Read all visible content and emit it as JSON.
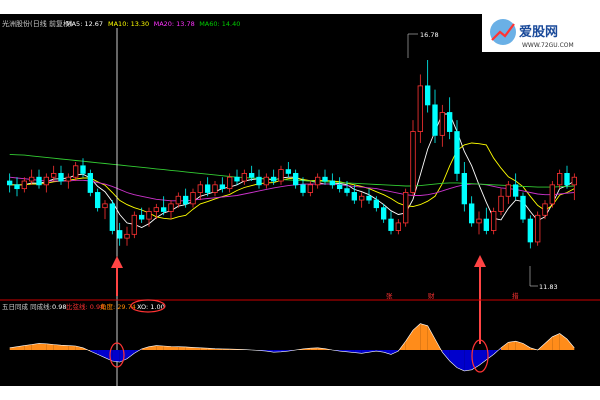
{
  "header": {
    "stock_name": "光洲股份(日线 前复权)",
    "ma_items": [
      {
        "label": "MA5: 12.67",
        "color": "#ffffff"
      },
      {
        "label": "MA10: 13.30",
        "color": "#ffff00"
      },
      {
        "label": "MA20: 13.78",
        "color": "#ff33ff"
      },
      {
        "label": "MA60: 14.40",
        "color": "#00cc00"
      }
    ]
  },
  "logo": {
    "name": "爱股网",
    "url": "WWW.72GU.COM"
  },
  "price_annotations": {
    "high": "16.78",
    "low": "11.83"
  },
  "bottom_markers": [
    "张",
    "财",
    "措"
  ],
  "indicator_header": {
    "name": "五日同成 同成线:",
    "value": "0.98",
    "item1": "比弦线: 0.94",
    "item2": "角度: 29.74",
    "item3": "XO: 1.00"
  },
  "colors": {
    "background": "#000000",
    "up_candle": "#ff3333",
    "down_candle": "#00ffff",
    "ma5": "#ffffff",
    "ma10": "#ffff00",
    "ma20": "#cc33cc",
    "ma60": "#33cc33",
    "divider": "#cc0000",
    "osc_positive": "#ff8c1a",
    "osc_negative": "#0000cc",
    "arrow": "#ff4444",
    "highlight_circle": "#ff3333"
  },
  "chart_data": {
    "type": "candlestick",
    "title": "",
    "ylim": [
      11.0,
      17.2
    ],
    "candles": [
      [
        13.6,
        13.8,
        13.3,
        13.5
      ],
      [
        13.5,
        13.7,
        13.2,
        13.4
      ],
      [
        13.4,
        13.7,
        13.3,
        13.6
      ],
      [
        13.6,
        13.9,
        13.5,
        13.7
      ],
      [
        13.7,
        13.9,
        13.4,
        13.5
      ],
      [
        13.5,
        13.8,
        13.3,
        13.7
      ],
      [
        13.7,
        14.0,
        13.6,
        13.8
      ],
      [
        13.8,
        14.0,
        13.5,
        13.6
      ],
      [
        13.6,
        13.8,
        13.4,
        13.7
      ],
      [
        13.7,
        14.1,
        13.6,
        14.0
      ],
      [
        14.0,
        14.2,
        13.7,
        13.8
      ],
      [
        13.8,
        13.9,
        13.2,
        13.3
      ],
      [
        13.3,
        13.4,
        12.8,
        12.9
      ],
      [
        12.9,
        13.1,
        12.6,
        13.0
      ],
      [
        13.0,
        13.1,
        12.2,
        12.3
      ],
      [
        12.3,
        12.5,
        11.9,
        12.1
      ],
      [
        12.1,
        12.4,
        11.9,
        12.2
      ],
      [
        12.2,
        12.8,
        12.1,
        12.7
      ],
      [
        12.7,
        12.9,
        12.5,
        12.6
      ],
      [
        12.6,
        12.9,
        12.4,
        12.8
      ],
      [
        12.8,
        13.0,
        12.6,
        12.9
      ],
      [
        12.9,
        13.2,
        12.7,
        12.8
      ],
      [
        12.8,
        13.1,
        12.6,
        13.0
      ],
      [
        13.0,
        13.3,
        12.9,
        13.2
      ],
      [
        13.2,
        13.4,
        12.9,
        13.0
      ],
      [
        13.0,
        13.4,
        12.9,
        13.3
      ],
      [
        13.3,
        13.6,
        13.1,
        13.5
      ],
      [
        13.5,
        13.7,
        13.2,
        13.3
      ],
      [
        13.3,
        13.6,
        13.2,
        13.5
      ],
      [
        13.5,
        13.7,
        13.3,
        13.4
      ],
      [
        13.4,
        13.8,
        13.3,
        13.7
      ],
      [
        13.7,
        13.9,
        13.5,
        13.6
      ],
      [
        13.6,
        13.9,
        13.5,
        13.8
      ],
      [
        13.8,
        14.0,
        13.6,
        13.7
      ],
      [
        13.7,
        13.9,
        13.4,
        13.5
      ],
      [
        13.5,
        13.8,
        13.4,
        13.7
      ],
      [
        13.7,
        13.9,
        13.5,
        13.6
      ],
      [
        13.6,
        14.0,
        13.5,
        13.9
      ],
      [
        13.9,
        14.1,
        13.7,
        13.8
      ],
      [
        13.8,
        13.9,
        13.4,
        13.5
      ],
      [
        13.5,
        13.7,
        13.2,
        13.3
      ],
      [
        13.3,
        13.6,
        13.2,
        13.5
      ],
      [
        13.5,
        13.8,
        13.4,
        13.7
      ],
      [
        13.7,
        13.9,
        13.5,
        13.6
      ],
      [
        13.6,
        13.8,
        13.4,
        13.5
      ],
      [
        13.5,
        13.7,
        13.3,
        13.4
      ],
      [
        13.4,
        13.6,
        13.2,
        13.3
      ],
      [
        13.3,
        13.5,
        13.0,
        13.1
      ],
      [
        13.1,
        13.3,
        12.9,
        13.2
      ],
      [
        13.2,
        13.4,
        13.0,
        13.1
      ],
      [
        13.1,
        13.2,
        12.8,
        12.9
      ],
      [
        12.9,
        13.0,
        12.5,
        12.6
      ],
      [
        12.6,
        12.8,
        12.2,
        12.3
      ],
      [
        12.3,
        12.6,
        12.2,
        12.5
      ],
      [
        12.5,
        13.4,
        12.4,
        13.3
      ],
      [
        13.3,
        15.2,
        13.2,
        14.9
      ],
      [
        14.9,
        16.4,
        14.6,
        16.1
      ],
      [
        16.1,
        16.78,
        15.4,
        15.6
      ],
      [
        15.6,
        16.0,
        14.6,
        14.8
      ],
      [
        14.8,
        15.6,
        14.5,
        15.4
      ],
      [
        15.4,
        15.8,
        14.7,
        14.9
      ],
      [
        14.9,
        15.2,
        13.6,
        13.8
      ],
      [
        13.8,
        14.1,
        12.8,
        13.0
      ],
      [
        13.0,
        13.2,
        12.4,
        12.5
      ],
      [
        12.5,
        12.8,
        12.2,
        12.6
      ],
      [
        12.6,
        12.9,
        12.2,
        12.3
      ],
      [
        12.3,
        12.9,
        12.2,
        12.8
      ],
      [
        12.8,
        13.4,
        12.7,
        13.2
      ],
      [
        13.2,
        13.6,
        13.0,
        13.5
      ],
      [
        13.5,
        13.8,
        13.1,
        13.2
      ],
      [
        13.2,
        13.3,
        12.5,
        12.6
      ],
      [
        12.6,
        12.7,
        11.83,
        12.0
      ],
      [
        12.0,
        12.8,
        11.9,
        12.7
      ],
      [
        12.7,
        13.1,
        12.6,
        13.0
      ],
      [
        13.0,
        13.6,
        12.9,
        13.5
      ],
      [
        13.5,
        13.9,
        13.4,
        13.8
      ],
      [
        13.8,
        14.0,
        13.4,
        13.5
      ],
      [
        13.5,
        13.8,
        13.1,
        13.7
      ]
    ],
    "series": [
      {
        "name": "MA5",
        "values": [
          13.5,
          13.5,
          13.5,
          13.55,
          13.54,
          13.58,
          13.65,
          13.66,
          13.68,
          13.76,
          13.78,
          13.68,
          13.46,
          13.32,
          13.06,
          12.72,
          12.5,
          12.46,
          12.38,
          12.48,
          12.64,
          12.76,
          12.82,
          12.94,
          12.98,
          13.06,
          13.2,
          13.26,
          13.32,
          13.4,
          13.44,
          13.5,
          13.6,
          13.64,
          13.66,
          13.66,
          13.62,
          13.68,
          13.7,
          13.7,
          13.62,
          13.6,
          13.56,
          13.52,
          13.52,
          13.54,
          13.5,
          13.38,
          13.32,
          13.24,
          13.12,
          12.98,
          12.82,
          12.72,
          12.76,
          13.12,
          13.76,
          14.44,
          14.9,
          15.36,
          15.36,
          14.9,
          14.38,
          14.0,
          13.5,
          13.04,
          12.62,
          12.58,
          12.88,
          13.1,
          13.06,
          12.8,
          12.56,
          12.66,
          13.0,
          13.4,
          13.48,
          13.6
        ]
      },
      {
        "name": "MA10",
        "values": [
          13.5,
          13.5,
          13.5,
          13.52,
          13.52,
          13.54,
          13.58,
          13.6,
          13.62,
          13.65,
          13.68,
          13.68,
          13.58,
          13.49,
          13.3,
          13.09,
          12.98,
          12.9,
          12.84,
          12.76,
          12.66,
          12.62,
          12.6,
          12.66,
          12.7,
          12.86,
          13.0,
          13.06,
          13.13,
          13.19,
          13.25,
          13.35,
          13.43,
          13.48,
          13.53,
          13.55,
          13.56,
          13.62,
          13.66,
          13.68,
          13.64,
          13.61,
          13.62,
          13.61,
          13.6,
          13.58,
          13.54,
          13.5,
          13.46,
          13.4,
          13.32,
          13.24,
          13.14,
          13.02,
          12.95,
          12.93,
          12.98,
          13.07,
          13.2,
          13.53,
          14.0,
          14.4,
          14.55,
          14.6,
          14.58,
          14.55,
          14.2,
          13.94,
          13.71,
          13.6,
          13.45,
          13.2,
          12.96,
          12.83,
          12.96,
          13.23,
          13.3,
          13.4
        ]
      },
      {
        "name": "MA20",
        "values": [
          13.7,
          13.68,
          13.66,
          13.64,
          13.62,
          13.6,
          13.6,
          13.6,
          13.6,
          13.62,
          13.62,
          13.6,
          13.56,
          13.52,
          13.46,
          13.38,
          13.3,
          13.24,
          13.2,
          13.16,
          13.12,
          13.1,
          13.08,
          13.08,
          13.08,
          13.1,
          13.12,
          13.14,
          13.16,
          13.18,
          13.2,
          13.22,
          13.26,
          13.3,
          13.34,
          13.38,
          13.42,
          13.45,
          13.48,
          13.5,
          13.52,
          13.52,
          13.52,
          13.52,
          13.52,
          13.5,
          13.48,
          13.46,
          13.44,
          13.42,
          13.4,
          13.36,
          13.32,
          13.28,
          13.24,
          13.22,
          13.22,
          13.24,
          13.28,
          13.34,
          13.4,
          13.46,
          13.5,
          13.52,
          13.52,
          13.5,
          13.46,
          13.42,
          13.4,
          13.38,
          13.34,
          13.3,
          13.26,
          13.24,
          13.24,
          13.26,
          13.28,
          13.3
        ]
      },
      {
        "name": "MA60",
        "values": [
          14.3,
          14.29,
          14.28,
          14.26,
          14.24,
          14.22,
          14.2,
          14.18,
          14.16,
          14.14,
          14.12,
          14.1,
          14.08,
          14.06,
          14.04,
          14.02,
          14.0,
          13.98,
          13.96,
          13.94,
          13.92,
          13.9,
          13.88,
          13.86,
          13.84,
          13.82,
          13.8,
          13.78,
          13.76,
          13.74,
          13.72,
          13.7,
          13.69,
          13.68,
          13.67,
          13.66,
          13.65,
          13.64,
          13.63,
          13.62,
          13.61,
          13.6,
          13.59,
          13.58,
          13.57,
          13.56,
          13.55,
          13.54,
          13.53,
          13.52,
          13.51,
          13.5,
          13.49,
          13.48,
          13.47,
          13.47,
          13.48,
          13.5,
          13.52,
          13.54,
          13.55,
          13.55,
          13.54,
          13.53,
          13.52,
          13.51,
          13.5,
          13.49,
          13.48,
          13.47,
          13.46,
          13.45,
          13.44,
          13.44,
          13.44,
          13.45,
          13.46,
          13.47
        ]
      }
    ],
    "oscillator": {
      "name": "同成线",
      "values": [
        0.1,
        0.15,
        0.2,
        0.25,
        0.3,
        0.28,
        0.25,
        0.22,
        0.2,
        0.18,
        0.1,
        -0.05,
        -0.2,
        -0.35,
        -0.5,
        -0.55,
        -0.4,
        -0.15,
        0.05,
        0.15,
        0.2,
        0.18,
        0.16,
        0.15,
        0.14,
        0.12,
        0.1,
        0.08,
        0.06,
        0.05,
        0.04,
        0.03,
        0.02,
        0.0,
        -0.02,
        -0.05,
        -0.1,
        -0.08,
        -0.05,
        0.0,
        0.05,
        0.08,
        0.1,
        0.06,
        0.0,
        -0.05,
        -0.08,
        -0.12,
        -0.15,
        -0.1,
        -0.05,
        -0.1,
        -0.2,
        -0.05,
        0.4,
        0.9,
        1.2,
        1.1,
        0.5,
        -0.1,
        -0.5,
        -0.8,
        -0.95,
        -0.9,
        -0.7,
        -0.45,
        -0.2,
        0.1,
        0.35,
        0.4,
        0.3,
        0.1,
        0.0,
        0.3,
        0.6,
        0.75,
        0.5,
        0.1
      ]
    }
  }
}
